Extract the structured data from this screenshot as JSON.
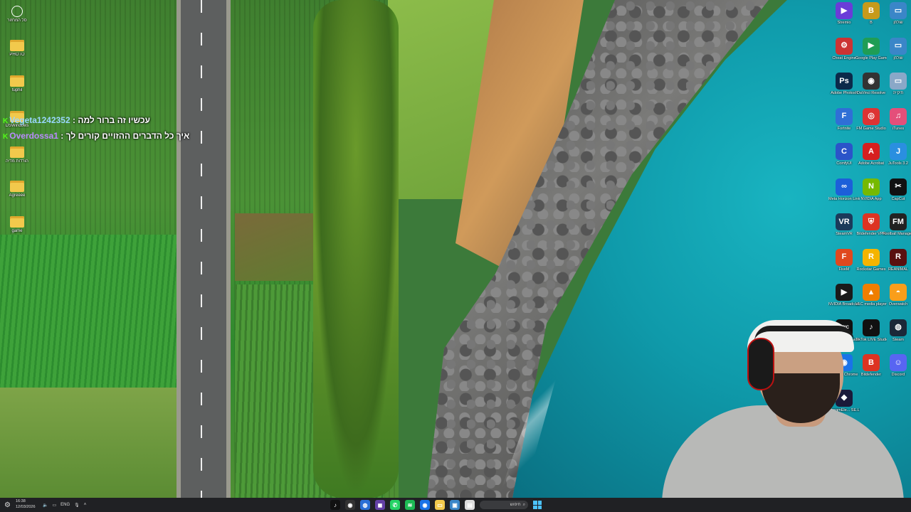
{
  "desktop": {
    "left_icons": [
      {
        "name": "recycle-bin",
        "icon": "recycle-icon",
        "label": "סל המחזור"
      },
      {
        "name": "folder-photo",
        "icon": "folder-icon",
        "label": "PHOTO"
      },
      {
        "name": "folder-tuphil",
        "icon": "folder-icon",
        "label": "tuphil"
      },
      {
        "name": "folder-windows",
        "icon": "folder-icon",
        "label": "DSWindows"
      },
      {
        "name": "folder-hebrew",
        "icon": "folder-icon",
        "label": "הורדות מדיה"
      },
      {
        "name": "folder-agreee",
        "icon": "folder-icon",
        "label": "Agreeee"
      },
      {
        "name": "folder-game",
        "icon": "folder-icon",
        "label": "game"
      }
    ],
    "right_icons": [
      {
        "name": "stremio",
        "label": "Stremio",
        "glyph": "▶",
        "color": "#6a3cd8"
      },
      {
        "name": "icon-b",
        "label": "B",
        "glyph": "B",
        "color": "#c79a1b"
      },
      {
        "name": "icon-hebrew-top",
        "label": "שולחן",
        "glyph": "▭",
        "color": "#3a86c8"
      },
      {
        "name": "cheat-engine",
        "label": "Cheat Engine",
        "glyph": "⚙",
        "color": "#c33"
      },
      {
        "name": "google-play-games",
        "label": "Google Play Games",
        "glyph": "▶",
        "color": "#1f9d55"
      },
      {
        "name": "icon-hebrew-2",
        "label": "שולחן",
        "glyph": "▭",
        "color": "#3a86c8"
      },
      {
        "name": "photoshop",
        "label": "Adobe Photosh",
        "glyph": "Ps",
        "color": "#0b2a4a"
      },
      {
        "name": "davinci-resolve",
        "label": "DaVinci Resolve",
        "glyph": "◉",
        "color": "#333"
      },
      {
        "name": "icon-hebrew-3",
        "label": "תיקייה",
        "glyph": "▭",
        "color": "#8aa8c8"
      },
      {
        "name": "fortnite",
        "label": "Fortnite",
        "glyph": "F",
        "color": "#2f6fd6"
      },
      {
        "name": "ea-sports-fc",
        "label": "FM Game Studio",
        "glyph": "◎",
        "color": "#d33"
      },
      {
        "name": "itunes",
        "label": "iTunes",
        "glyph": "♫",
        "color": "#e44f7a"
      },
      {
        "name": "comfyui",
        "label": "ComfyUI",
        "glyph": "C",
        "color": "#2b54c9"
      },
      {
        "name": "adobe-acrobat",
        "label": "Adobe Acrobat",
        "glyph": "A",
        "color": "#d61f1f"
      },
      {
        "name": "jutools",
        "label": "JuTools 3.2",
        "glyph": "J",
        "color": "#2a8fe0"
      },
      {
        "name": "meta-horizon-link",
        "label": "Meta Horizon Link",
        "glyph": "∞",
        "color": "#1c5fd9"
      },
      {
        "name": "nvidia-app",
        "label": "NVIDIA App",
        "glyph": "N",
        "color": "#76b900"
      },
      {
        "name": "capcut",
        "label": "CapCut",
        "glyph": "✂",
        "color": "#111"
      },
      {
        "name": "steamvr",
        "label": "SteamVR",
        "glyph": "VR",
        "color": "#1b3a5a"
      },
      {
        "name": "bitdefender-vpn",
        "label": "Bitdefender VPN",
        "glyph": "⛨",
        "color": "#d32"
      },
      {
        "name": "football-manager",
        "label": "Football Manager 26",
        "glyph": "FM",
        "color": "#222"
      },
      {
        "name": "fivem",
        "label": "FiveM",
        "glyph": "F",
        "color": "#e0481e"
      },
      {
        "name": "rockstar-games",
        "label": "Rockstar Games",
        "glyph": "R",
        "color": "#f4b400"
      },
      {
        "name": "reanimal",
        "label": "REANIMAL",
        "glyph": "R",
        "color": "#5a1010"
      },
      {
        "name": "nvidia-broadcast",
        "label": "NVIDIA Broadcast",
        "glyph": "▶",
        "color": "#1a1a1a"
      },
      {
        "name": "vlc",
        "label": "VLC media player",
        "glyph": "▲",
        "color": "#ef7e00"
      },
      {
        "name": "overwatch",
        "label": "Overwatch",
        "glyph": "◓",
        "color": "#f99e1a"
      },
      {
        "name": "epic-games",
        "label": "Epic Games Launcher",
        "glyph": "EPIC",
        "color": "#111"
      },
      {
        "name": "tiktok-live-studio",
        "label": "TikTok LIVE Studio",
        "glyph": "♪",
        "color": "#111"
      },
      {
        "name": "steam",
        "label": "Steam",
        "glyph": "◍",
        "color": "#1b2838"
      },
      {
        "name": "google-chrome",
        "label": "Google Chrome",
        "glyph": "◉",
        "color": "#1a73e8"
      },
      {
        "name": "bitdefender",
        "label": "Bitdefender",
        "glyph": "B",
        "color": "#d32"
      },
      {
        "name": "discord",
        "label": "Discord",
        "glyph": "☺",
        "color": "#5865f2"
      },
      {
        "name": "streamelements",
        "label": "StreamEle... SE.Live",
        "glyph": "◆",
        "color": "#1a1a3a"
      }
    ]
  },
  "chat": {
    "messages": [
      {
        "user": "Vegeta1242352",
        "separator": ":",
        "text": "עכשיו זה ברור למה"
      },
      {
        "user": "Overdossa1",
        "separator": ":",
        "text": "איך כל הדברים ההזויים קורים לך"
      }
    ],
    "colors": {
      "badge": "#53fc18",
      "user1": "#9ad7ff",
      "user2": "#b98bff"
    }
  },
  "taskbar": {
    "time": "16:38",
    "date": "12/03/2026",
    "language": "ENG",
    "search_label": "חיפוש",
    "pinned": [
      {
        "name": "tiktok",
        "glyph": "♪",
        "color": "#111"
      },
      {
        "name": "obs",
        "glyph": "◉",
        "color": "#333"
      },
      {
        "name": "browser",
        "glyph": "◍",
        "color": "#2a6fd6"
      },
      {
        "name": "twitch",
        "glyph": "◼",
        "color": "#6441a5"
      },
      {
        "name": "whatsapp",
        "glyph": "✆",
        "color": "#25d366"
      },
      {
        "name": "spotify",
        "glyph": "≋",
        "color": "#1db954"
      },
      {
        "name": "chrome",
        "glyph": "◉",
        "color": "#1a73e8"
      },
      {
        "name": "file-explorer",
        "glyph": "▭",
        "color": "#f2c94c"
      },
      {
        "name": "photos",
        "glyph": "▣",
        "color": "#3a86c8"
      },
      {
        "name": "notepad",
        "glyph": "▤",
        "color": "#dcdcdc"
      }
    ],
    "accent": "#4cc2ff"
  }
}
